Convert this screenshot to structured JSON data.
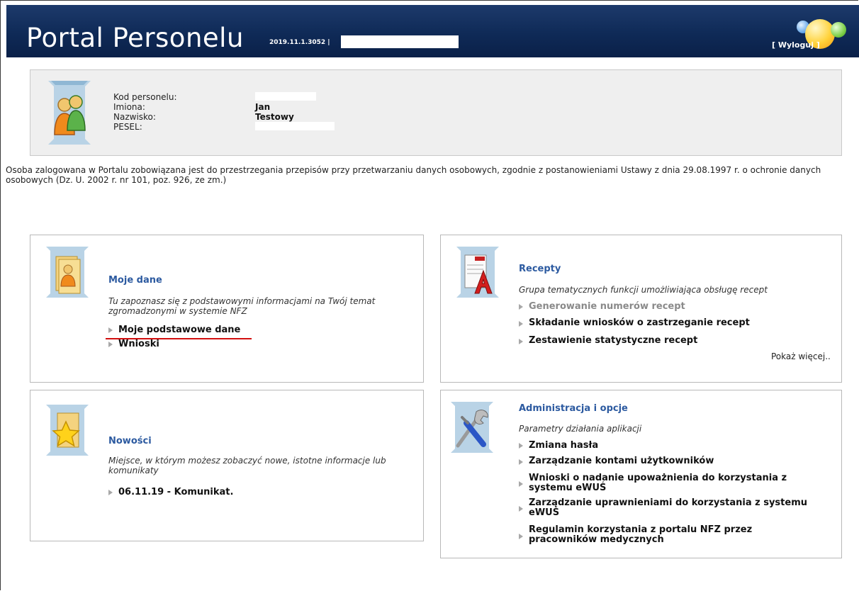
{
  "header": {
    "title": "Portal Personelu",
    "version": "2019.11.1.3052 |",
    "logout_label": "[ Wyloguj ]"
  },
  "person": {
    "labels": [
      "Kod personelu:",
      "Imiona:",
      "Nazwisko:",
      "PESEL:"
    ],
    "first_name": "Jan",
    "last_name": "Testowy"
  },
  "notice": "Osoba zalogowana w Portalu zobowiązana jest do przestrzegania przepisów przy przetwarzaniu danych osobowych, zgodnie z postanowieniami Ustawy z dnia 29.08.1997 r. o ochronie danych osobowych (Dz. U. 2002 r. nr 101, poz. 926, ze zm.)",
  "panels": {
    "moje_dane": {
      "title": "Moje dane",
      "description": "Tu zapoznasz się z podstawowymi informacjami na Twój temat zgromadzonymi w systemie NFZ",
      "links": [
        "Moje podstawowe dane",
        "Wnioski"
      ]
    },
    "recepty": {
      "title": "Recepty",
      "description": "Grupa tematycznych funkcji umożliwiająca obsługę recept",
      "links": [
        "Generowanie numerów recept",
        "Składanie wniosków o zastrzeganie recept",
        "Zestawienie statystyczne recept"
      ],
      "more": "Pokaż więcej.."
    },
    "nowosci": {
      "title": "Nowości",
      "description": "Miejsce, w którym możesz zobaczyć nowe, istotne informacje lub komunikaty",
      "links": [
        "06.11.19 - Komunikat."
      ]
    },
    "administracja": {
      "title": "Administracja i opcje",
      "description": "Parametry działania aplikacji",
      "links": [
        "Zmiana hasła",
        "Zarządzanie kontami użytkowników",
        "Wnioski o nadanie upoważnienia do korzystania z systemu eWUŚ",
        "Zarządzanie uprawnieniami do korzystania z systemu eWUŚ",
        "Regulamin korzystania z portalu NFZ przez pracowników medycznych"
      ]
    }
  },
  "colors": {
    "header_bg": "#0f2a57",
    "title_blue": "#2c5aa0",
    "highlight_underline": "#d21010",
    "disabled_link": "#8a8a8a"
  }
}
